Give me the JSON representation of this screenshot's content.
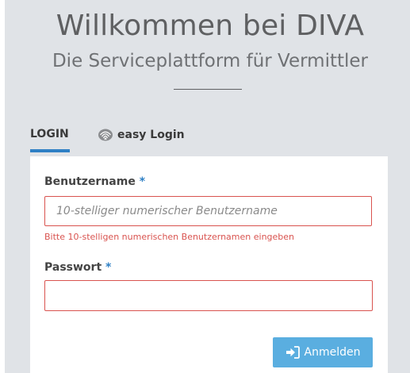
{
  "header": {
    "title": "Willkommen bei DIVA",
    "subtitle": "Die Serviceplattform für Vermittler"
  },
  "tabs": [
    {
      "label": "LOGIN",
      "active": true
    },
    {
      "label": "easy Login",
      "icon": "fingerprint-icon",
      "active": false
    }
  ],
  "form": {
    "username": {
      "label": "Benutzername",
      "required_marker": "*",
      "placeholder": "10-stelliger numerischer Benutzername",
      "value": "",
      "error": "Bitte 10-stelligen numerischen Benutzernamen eingeben"
    },
    "password": {
      "label": "Passwort",
      "required_marker": "*",
      "value": ""
    },
    "submit": {
      "label": "Anmelden",
      "icon": "sign-in-icon"
    }
  },
  "colors": {
    "background": "#e0e3e7",
    "accent": "#2f80c5",
    "error": "#d9534f",
    "button": "#5aaee0"
  }
}
